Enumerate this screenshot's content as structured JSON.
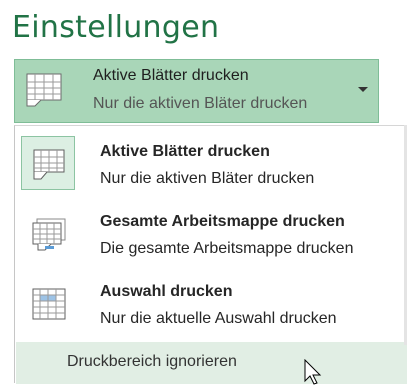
{
  "section": {
    "heading": "Einstellungen"
  },
  "selector": {
    "title": "Aktive Blätter drucken",
    "subtitle": "Nur die aktiven Bläter drucken",
    "icon": "sheet-icon",
    "arrow_icon": "dropdown-arrow-icon"
  },
  "options": [
    {
      "title": "Aktive Blätter drucken",
      "subtitle": "Nur die aktiven Bläter drucken",
      "icon": "active-sheets-icon",
      "selected": true
    },
    {
      "title": "Gesamte Arbeitsmappe drucken",
      "subtitle": "Die gesamte Arbeitsmappe drucken",
      "icon": "workbook-icon",
      "selected": false
    },
    {
      "title": "Auswahl drucken",
      "subtitle": "Nur die aktuelle Auswahl drucken",
      "icon": "selection-icon",
      "selected": false
    }
  ],
  "ignore_print_area": {
    "label": "Druckbereich ignorieren",
    "highlighted": true
  },
  "colors": {
    "accent": "#217346",
    "selector_bg": "#a9d6b8",
    "selected_option_bg": "#dcefe3",
    "hover_row_bg": "#e1eee4"
  }
}
